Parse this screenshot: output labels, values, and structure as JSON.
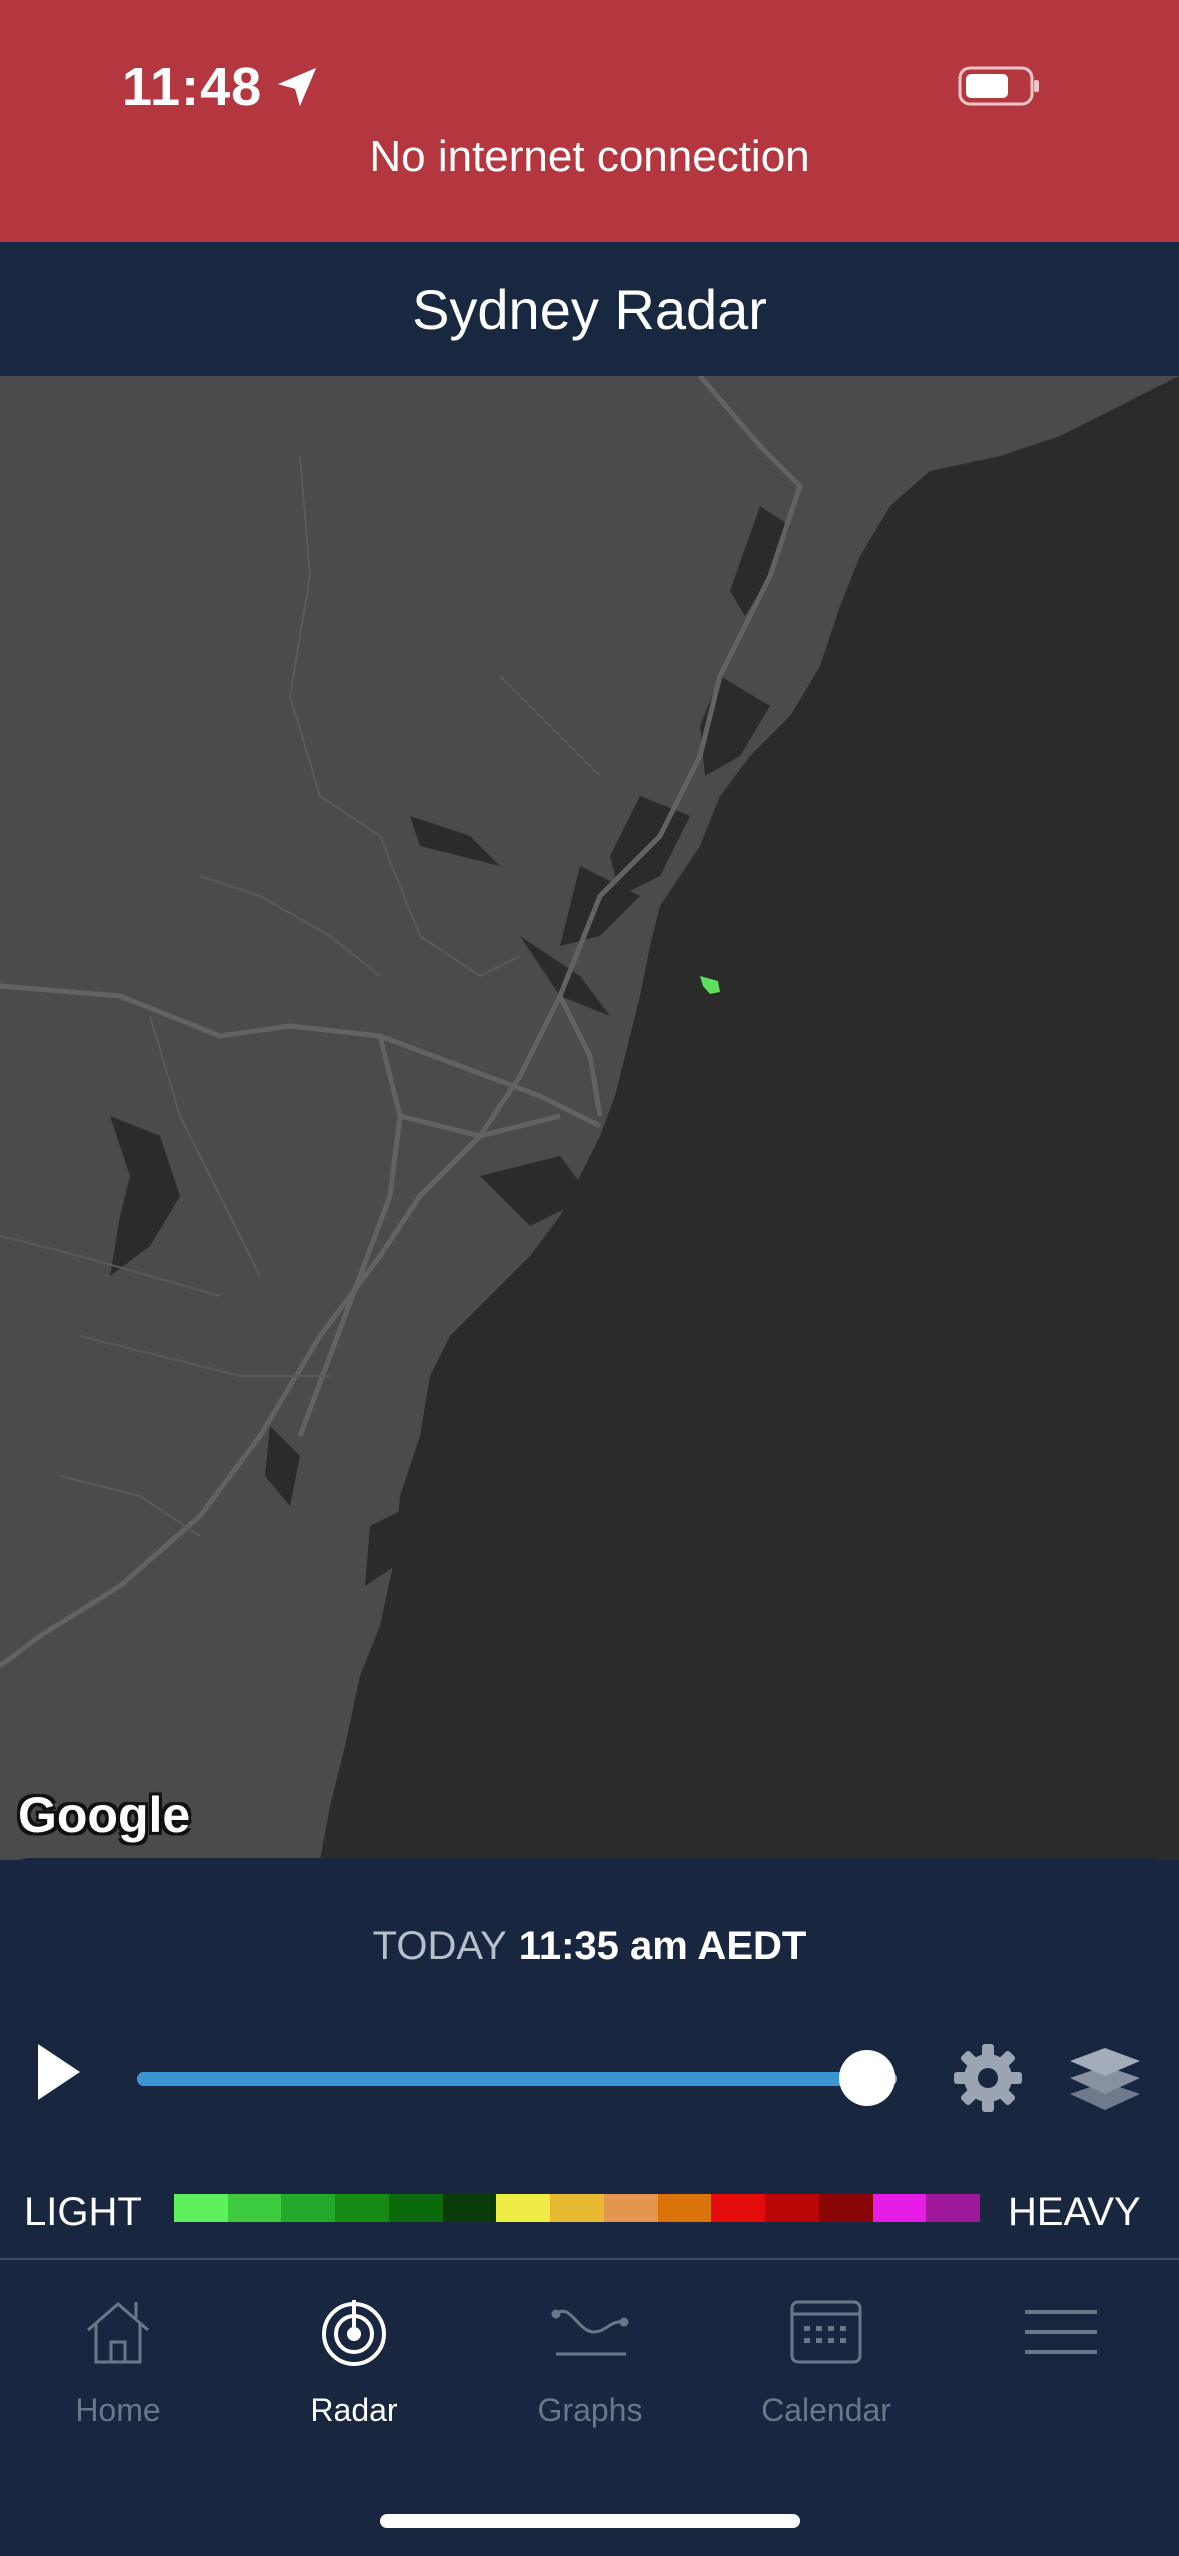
{
  "status": {
    "time": "11:48",
    "banner_text": "No internet connection"
  },
  "header": {
    "title": "Sydney Radar"
  },
  "map": {
    "attribution": "Google"
  },
  "playback": {
    "day_label": "TODAY",
    "time_label": "11:35 am AEDT",
    "progress": 0.96
  },
  "legend": {
    "light_label": "LIGHT",
    "heavy_label": "HEAVY",
    "colors": [
      "#5ff060",
      "#3fcb3f",
      "#23aa2a",
      "#158b15",
      "#0b6a0b",
      "#0a3a0a",
      "#f0ea45",
      "#e7b832",
      "#e49550",
      "#dc720a",
      "#e40b0b",
      "#b90707",
      "#8a0606",
      "#e61de6",
      "#a0189b"
    ]
  },
  "tabs": [
    {
      "label": "Home",
      "icon": "home-icon",
      "active": false
    },
    {
      "label": "Radar",
      "icon": "radar-icon",
      "active": true
    },
    {
      "label": "Graphs",
      "icon": "graphs-icon",
      "active": false
    },
    {
      "label": "Calendar",
      "icon": "calendar-icon",
      "active": false
    },
    {
      "label": "",
      "icon": "menu-icon",
      "active": false
    }
  ]
}
